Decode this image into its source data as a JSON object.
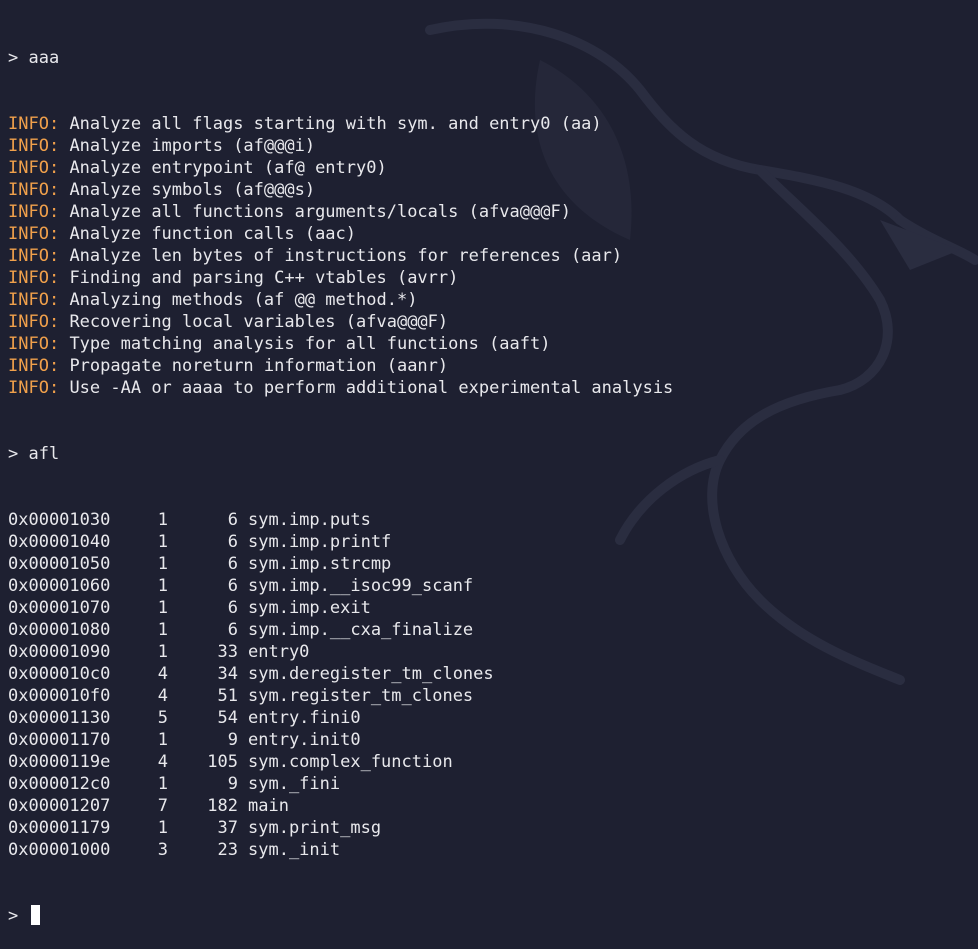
{
  "theme": {
    "background": "#1e2031",
    "text": "#e8e8ec",
    "info_color": "#f0a04b"
  },
  "prompt_symbol": ">",
  "commands": [
    "aaa",
    "afl"
  ],
  "info_tag": "INFO:",
  "info_lines": [
    "Analyze all flags starting with sym. and entry0 (aa)",
    "Analyze imports (af@@@i)",
    "Analyze entrypoint (af@ entry0)",
    "Analyze symbols (af@@@s)",
    "Analyze all functions arguments/locals (afva@@@F)",
    "Analyze function calls (aac)",
    "Analyze len bytes of instructions for references (aar)",
    "Finding and parsing C++ vtables (avrr)",
    "Analyzing methods (af @@ method.*)",
    "Recovering local variables (afva@@@F)",
    "Type matching analysis for all functions (aaft)",
    "Propagate noreturn information (aanr)",
    "Use -AA or aaaa to perform additional experimental analysis"
  ],
  "functions": [
    {
      "addr": "0x00001030",
      "nbbs": "1",
      "size": "6",
      "name": "sym.imp.puts"
    },
    {
      "addr": "0x00001040",
      "nbbs": "1",
      "size": "6",
      "name": "sym.imp.printf"
    },
    {
      "addr": "0x00001050",
      "nbbs": "1",
      "size": "6",
      "name": "sym.imp.strcmp"
    },
    {
      "addr": "0x00001060",
      "nbbs": "1",
      "size": "6",
      "name": "sym.imp.__isoc99_scanf"
    },
    {
      "addr": "0x00001070",
      "nbbs": "1",
      "size": "6",
      "name": "sym.imp.exit"
    },
    {
      "addr": "0x00001080",
      "nbbs": "1",
      "size": "6",
      "name": "sym.imp.__cxa_finalize"
    },
    {
      "addr": "0x00001090",
      "nbbs": "1",
      "size": "33",
      "name": "entry0"
    },
    {
      "addr": "0x000010c0",
      "nbbs": "4",
      "size": "34",
      "name": "sym.deregister_tm_clones"
    },
    {
      "addr": "0x000010f0",
      "nbbs": "4",
      "size": "51",
      "name": "sym.register_tm_clones"
    },
    {
      "addr": "0x00001130",
      "nbbs": "5",
      "size": "54",
      "name": "entry.fini0"
    },
    {
      "addr": "0x00001170",
      "nbbs": "1",
      "size": "9",
      "name": "entry.init0"
    },
    {
      "addr": "0x0000119e",
      "nbbs": "4",
      "size": "105",
      "name": "sym.complex_function"
    },
    {
      "addr": "0x000012c0",
      "nbbs": "1",
      "size": "9",
      "name": "sym._fini"
    },
    {
      "addr": "0x00001207",
      "nbbs": "7",
      "size": "182",
      "name": "main"
    },
    {
      "addr": "0x00001179",
      "nbbs": "1",
      "size": "37",
      "name": "sym.print_msg"
    },
    {
      "addr": "0x00001000",
      "nbbs": "3",
      "size": "23",
      "name": "sym._init"
    }
  ]
}
